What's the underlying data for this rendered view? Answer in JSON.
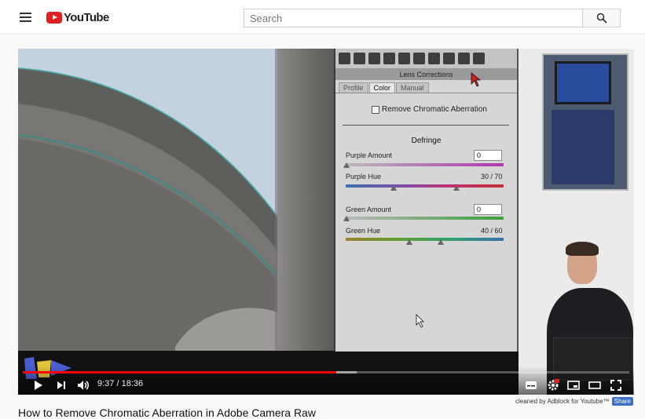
{
  "header": {
    "logo_text": "YouTube",
    "search_placeholder": "Search"
  },
  "player": {
    "acr": {
      "panel_title": "Lens Corrections",
      "tabs": [
        "Profile",
        "Color",
        "Manual"
      ],
      "active_tab": "Color",
      "checkbox_label": "Remove Chromatic Aberration",
      "checkbox_checked": false,
      "section_label": "Defringe",
      "sliders": [
        {
          "label": "Purple Amount",
          "value": "0"
        },
        {
          "label": "Purple Hue",
          "value": "30 / 70"
        },
        {
          "label": "Green Amount",
          "value": "0"
        },
        {
          "label": "Green Hue",
          "value": "40 / 60"
        }
      ]
    },
    "time": "9:37 / 18:36",
    "progress": 0.517,
    "buffered": 0.55
  },
  "footer": {
    "cleaned_text": "cleaned by Adblock for Youtube™",
    "share_label": "Share"
  },
  "video": {
    "title": "How to Remove Chromatic Aberration in Adobe Camera Raw"
  },
  "colors": {
    "youtube_red": "#ff0000",
    "share_blue": "#3a6fc8"
  }
}
